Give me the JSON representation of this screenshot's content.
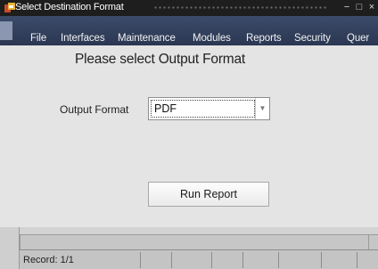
{
  "window": {
    "title": "Select Destination Format",
    "controls": [
      "−",
      "□",
      "×"
    ]
  },
  "menu": {
    "items": [
      "File",
      "Interfaces",
      "Maintenance",
      "Modules",
      "Reports",
      "Security",
      "Quer"
    ]
  },
  "form": {
    "heading": "Please select Output Format",
    "output_format_label": "Output Format",
    "output_format_value": "PDF",
    "run_button_label": "Run Report"
  },
  "status": {
    "record": "Record: 1/1"
  },
  "colors": {
    "titlebar": "#1e1e1e",
    "menubar": "#3c4b6a",
    "content": "#e4e4e4"
  },
  "icons": {
    "app": "oracle-app-icon",
    "dropdown": "chevron-down-icon"
  }
}
